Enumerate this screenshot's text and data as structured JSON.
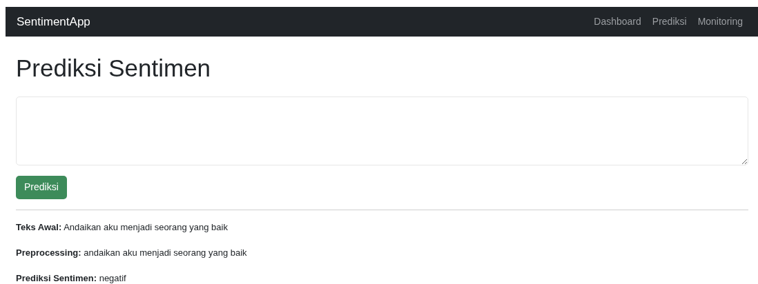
{
  "navbar": {
    "brand": "SentimentApp",
    "links": [
      "Dashboard",
      "Prediksi",
      "Monitoring"
    ]
  },
  "heading": "Prediksi Sentimen",
  "input": {
    "kind": "textarea"
  },
  "button": "Prediksi",
  "results": [
    "**Teks Awal:** Andaikan aku menjadi seorang yang baik",
    "**Preprocessing:** andaikan aku menjadi seorang yang baik",
    "**Prediksi Sentimen:** negatif"
  ]
}
